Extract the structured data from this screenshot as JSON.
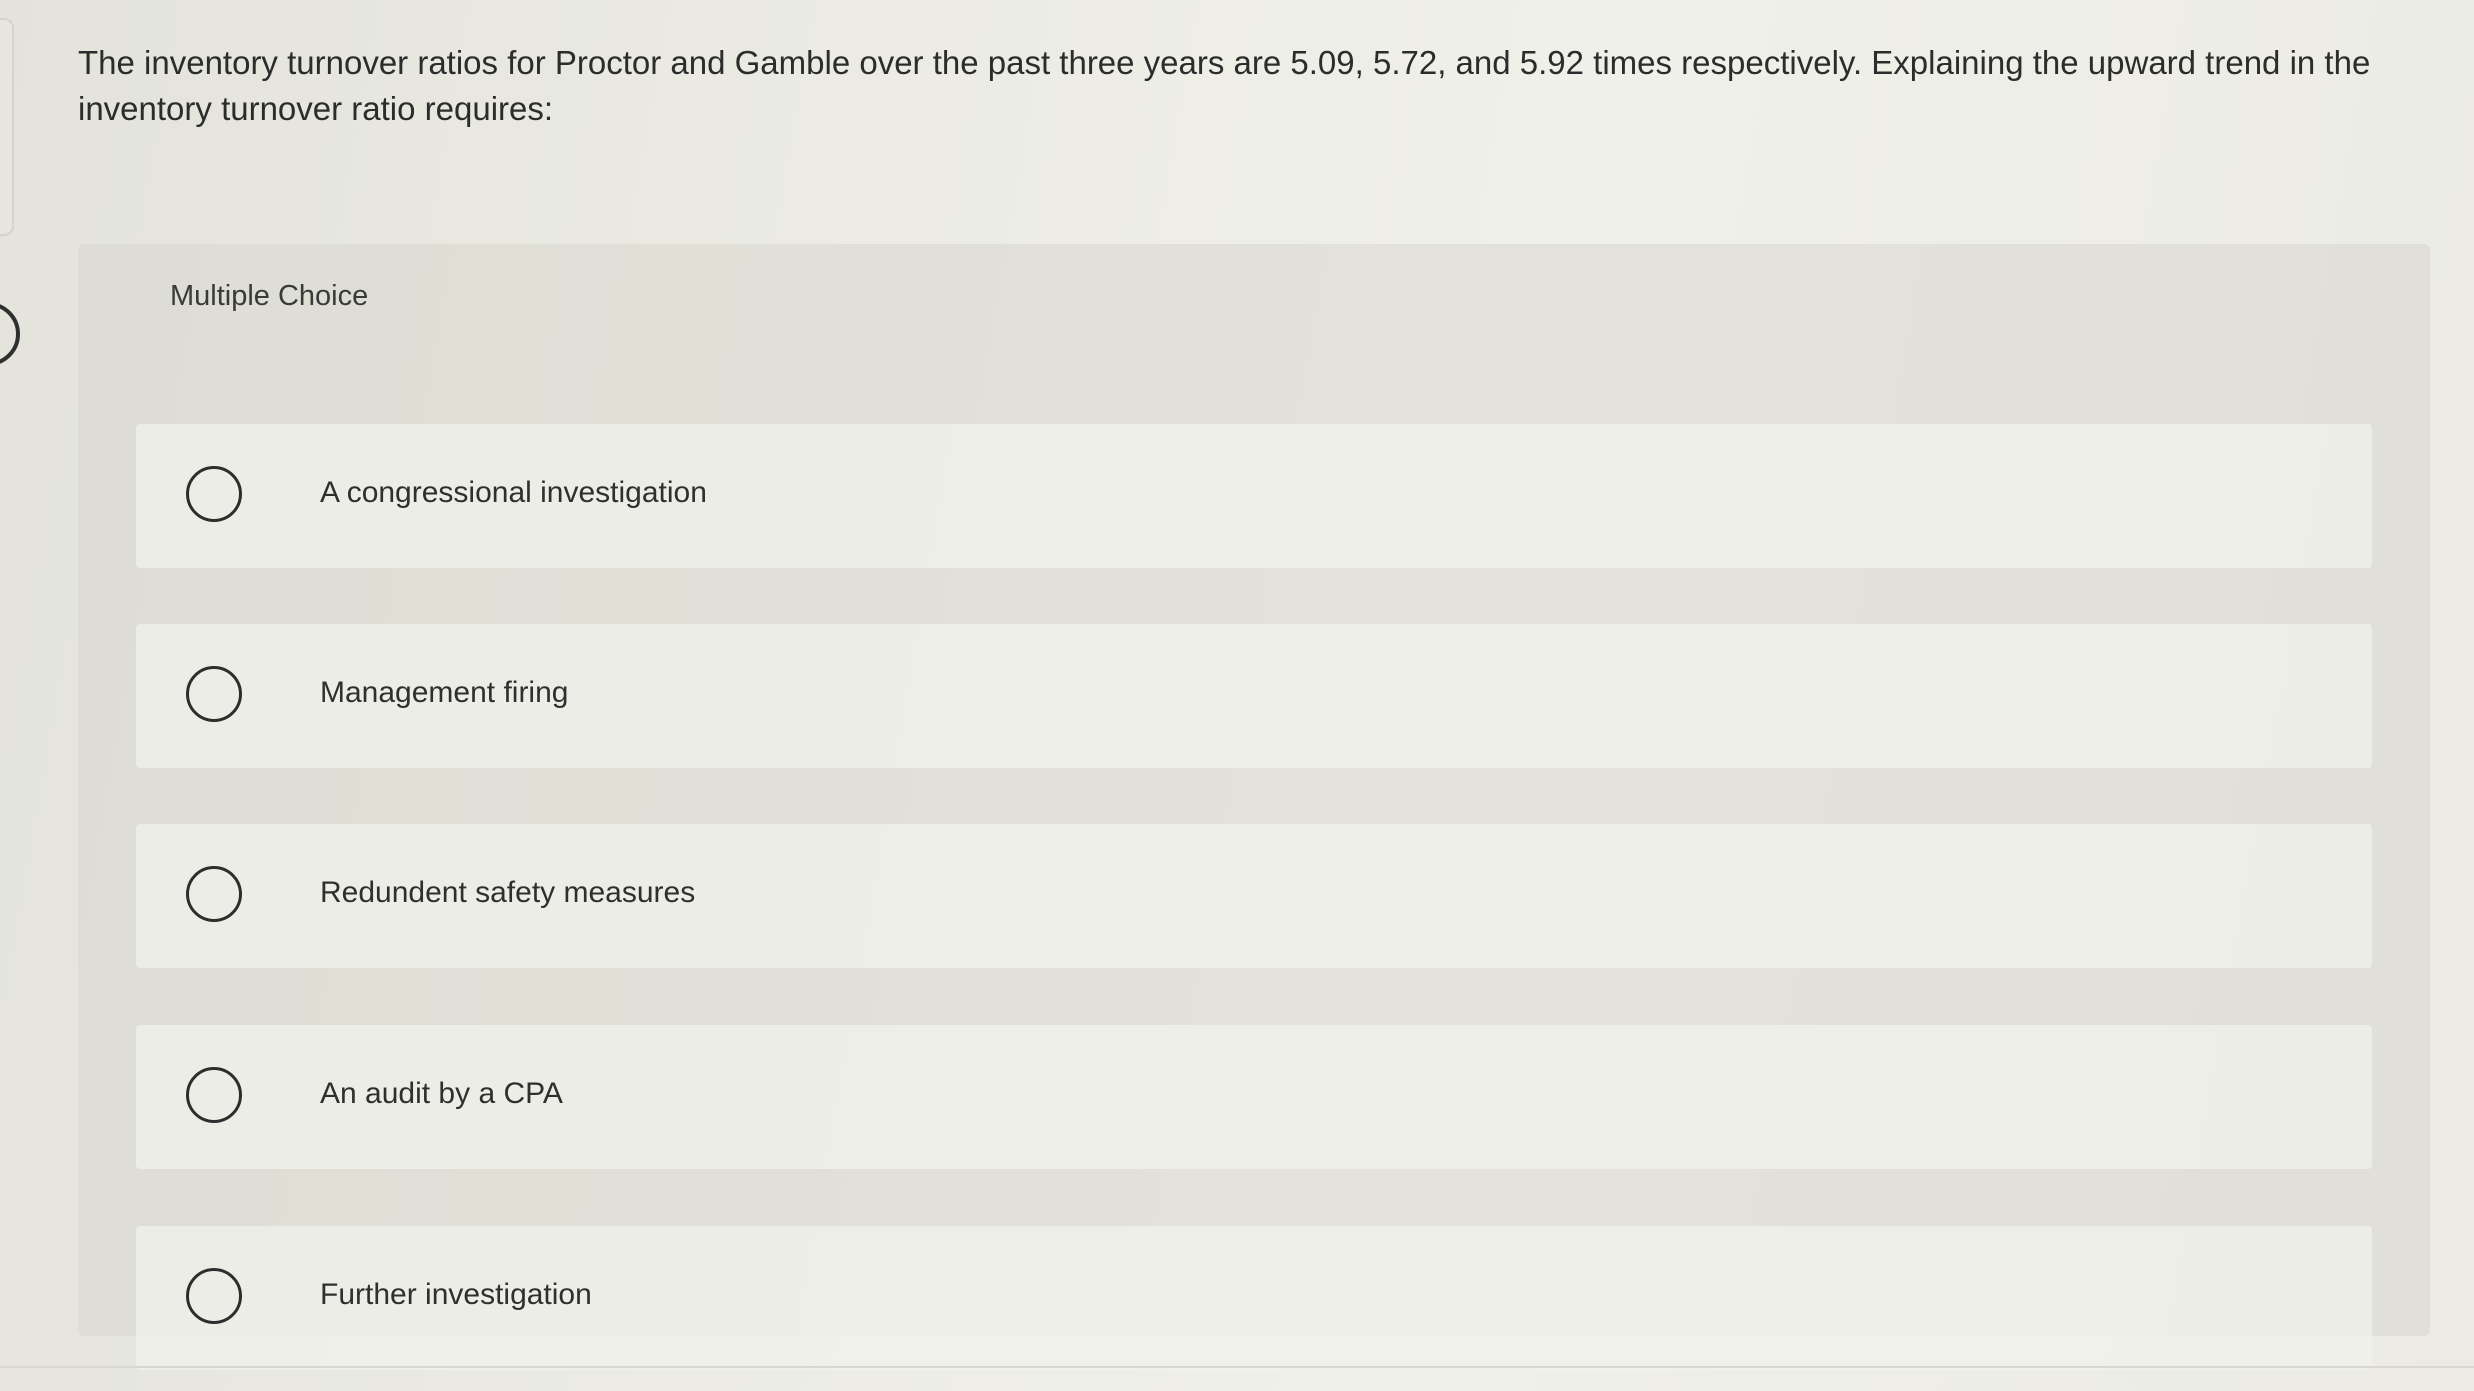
{
  "question": {
    "text": "The inventory turnover ratios for Proctor and Gamble over the past three years are 5.09, 5.72, and 5.92 times respectively.  Explaining the upward trend in the inventory turnover ratio requires:"
  },
  "choice_panel": {
    "label": "Multiple Choice",
    "options": [
      {
        "label": "A congressional investigation",
        "selected": false
      },
      {
        "label": "Management firing",
        "selected": false
      },
      {
        "label": "Redundent safety measures",
        "selected": false
      },
      {
        "label": "An audit by a CPA",
        "selected": false
      },
      {
        "label": "Further investigation",
        "selected": false
      }
    ]
  },
  "colors": {
    "background": "#ececE5",
    "panel": "#d7d7ce",
    "option": "#f2f2ec",
    "text": "#2c2c2c"
  }
}
